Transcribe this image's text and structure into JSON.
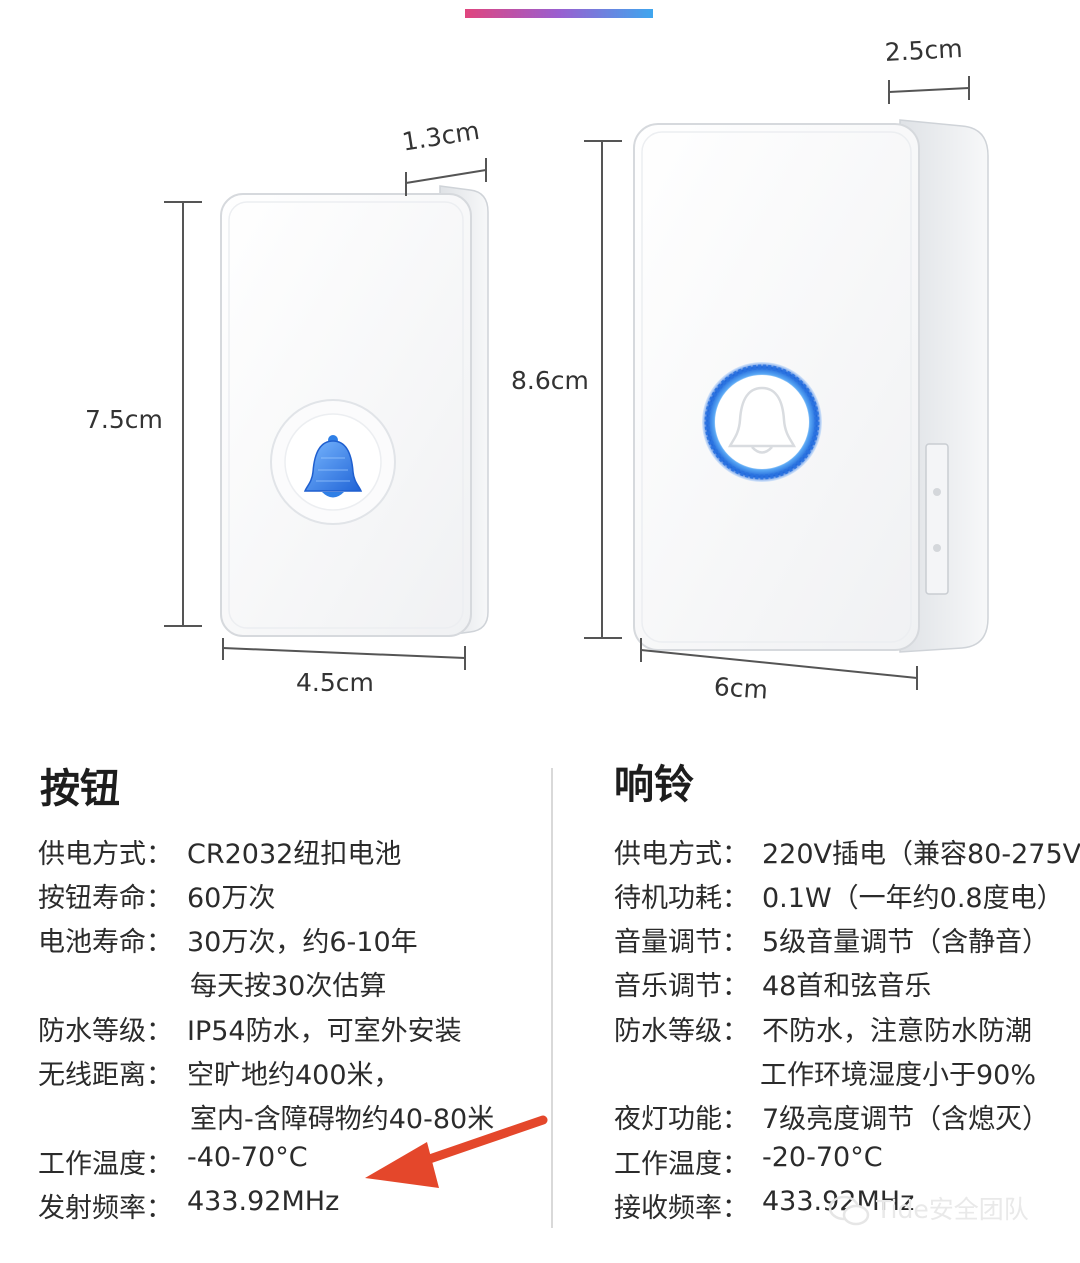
{
  "dimensions": {
    "button_depth": "1.3cm",
    "button_height": "7.5cm",
    "button_width": "4.5cm",
    "bell_depth": "2.5cm",
    "bell_height": "8.6cm",
    "bell_width": "6cm"
  },
  "left": {
    "title": "按钮",
    "specs": [
      {
        "label": "供电方式：",
        "value": "CR2032纽扣电池"
      },
      {
        "label": "按钮寿命：",
        "value": "60万次"
      },
      {
        "label": "电池寿命：",
        "value": "30万次，约6-10年"
      },
      {
        "label": "",
        "value": "每天按30次估算"
      },
      {
        "label": "防水等级：",
        "value": "IP54防水，可室外安装"
      },
      {
        "label": "无线距离：",
        "value": "空旷地约400米，"
      },
      {
        "label": "",
        "value": "室内-含障碍物约40-80米"
      },
      {
        "label": "工作温度：",
        "value": "-40-70°C"
      },
      {
        "label": "发射频率：",
        "value": "433.92MHz"
      }
    ]
  },
  "right": {
    "title": "响铃",
    "specs": [
      {
        "label": "供电方式：",
        "value": "220V插电（兼容80-275V"
      },
      {
        "label": "待机功耗：",
        "value": "0.1W（一年约0.8度电）"
      },
      {
        "label": "音量调节：",
        "value": "5级音量调节（含静音）"
      },
      {
        "label": "音乐调节：",
        "value": "48首和弦音乐"
      },
      {
        "label": "防水等级：",
        "value": "不防水，注意防水防潮"
      },
      {
        "label": "",
        "value": "工作环境湿度小于90%"
      },
      {
        "label": "夜灯功能：",
        "value": "7级亮度调节（含熄灭）"
      },
      {
        "label": "工作温度：",
        "value": "-20-70°C"
      },
      {
        "label": "接收频率：",
        "value": "433.92MHz"
      }
    ]
  },
  "watermark": "Tide安全团队",
  "colors": {
    "accent_blue": "#2f7fe6",
    "arrow_red": "#e4472b",
    "gradient_start": "#e0457e",
    "gradient_end": "#3fa6ee"
  },
  "icons": [
    "bell-icon",
    "bell-outline-icon",
    "arrow-icon",
    "wechat-icon"
  ]
}
